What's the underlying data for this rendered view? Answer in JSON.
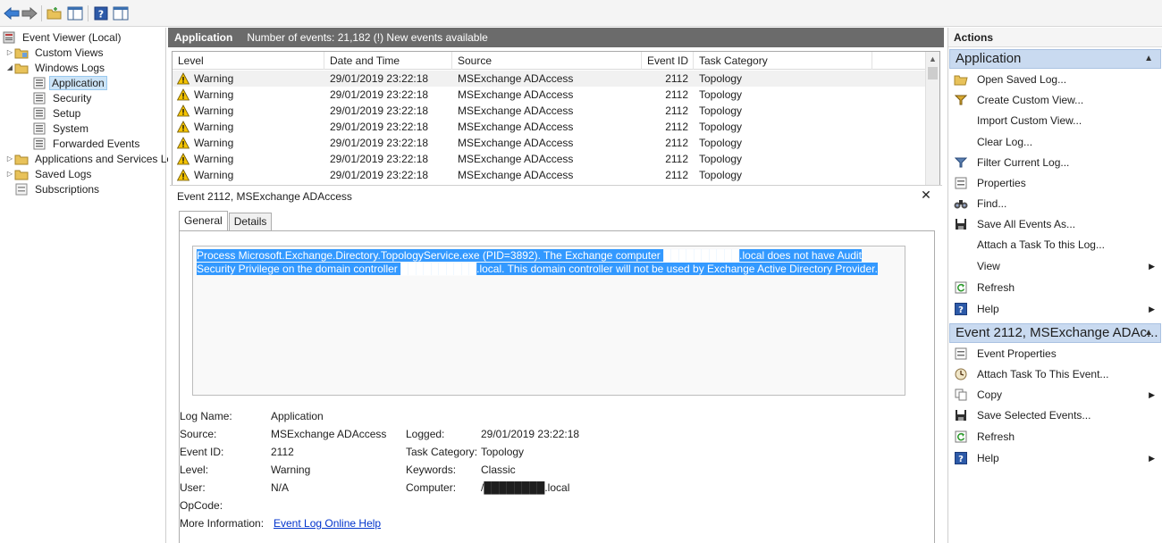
{
  "tree": {
    "root": "Event Viewer (Local)",
    "custom_views": "Custom Views",
    "windows_logs": "Windows Logs",
    "application": "Application",
    "security": "Security",
    "setup": "Setup",
    "system": "System",
    "forwarded_events": "Forwarded Events",
    "apps_services": "Applications and Services Lo",
    "saved_logs": "Saved Logs",
    "subscriptions": "Subscriptions"
  },
  "header": {
    "title": "Application",
    "event_count": "Number of events: 21,182 (!) New events available"
  },
  "grid": {
    "columns": [
      "Level",
      "Date and Time",
      "Source",
      "Event ID",
      "Task Category"
    ],
    "rows": [
      {
        "level": "Warning",
        "date": "29/01/2019 23:22:18",
        "source": "MSExchange ADAccess",
        "event_id": "2112",
        "category": "Topology"
      },
      {
        "level": "Warning",
        "date": "29/01/2019 23:22:18",
        "source": "MSExchange ADAccess",
        "event_id": "2112",
        "category": "Topology"
      },
      {
        "level": "Warning",
        "date": "29/01/2019 23:22:18",
        "source": "MSExchange ADAccess",
        "event_id": "2112",
        "category": "Topology"
      },
      {
        "level": "Warning",
        "date": "29/01/2019 23:22:18",
        "source": "MSExchange ADAccess",
        "event_id": "2112",
        "category": "Topology"
      },
      {
        "level": "Warning",
        "date": "29/01/2019 23:22:18",
        "source": "MSExchange ADAccess",
        "event_id": "2112",
        "category": "Topology"
      },
      {
        "level": "Warning",
        "date": "29/01/2019 23:22:18",
        "source": "MSExchange ADAccess",
        "event_id": "2112",
        "category": "Topology"
      },
      {
        "level": "Warning",
        "date": "29/01/2019 23:22:18",
        "source": "MSExchange ADAccess",
        "event_id": "2112",
        "category": "Topology"
      }
    ]
  },
  "detail": {
    "title": "Event 2112, MSExchange ADAccess",
    "tab_general": "General",
    "tab_details": "Details",
    "description": "Process Microsoft.Exchange.Directory.TopologyService.exe (PID=3892). The Exchange computer ██████████.local does not have Audit Security Privilege on the domain controller ██████████.local. This domain controller will not be used by Exchange Active Directory Provider.",
    "log_name_label": "Log Name:",
    "log_name": "Application",
    "source_label": "Source:",
    "source": "MSExchange ADAccess",
    "logged_label": "Logged:",
    "logged": "29/01/2019 23:22:18",
    "event_id_label": "Event ID:",
    "event_id": "2112",
    "task_category_label": "Task Category:",
    "task_category": "Topology",
    "level_label": "Level:",
    "level": "Warning",
    "keywords_label": "Keywords:",
    "keywords": "Classic",
    "user_label": "User:",
    "user": "N/A",
    "computer_label": "Computer:",
    "computer": "/████████.local",
    "opcode_label": "OpCode:",
    "more_info_label": "More Information:",
    "more_info_link": "Event Log Online Help"
  },
  "actions": {
    "title": "Actions",
    "section1": "Application",
    "open_saved_log": "Open Saved Log...",
    "create_custom_view": "Create Custom View...",
    "import_custom_view": "Import Custom View...",
    "clear_log": "Clear Log...",
    "filter_current_log": "Filter Current Log...",
    "properties": "Properties",
    "find": "Find...",
    "save_all_events_as": "Save All Events As...",
    "attach_task_log": "Attach a Task To this Log...",
    "view": "View",
    "refresh1": "Refresh",
    "help1": "Help",
    "section2": "Event 2112, MSExchange ADAc...",
    "event_properties": "Event Properties",
    "attach_task_event": "Attach Task To This Event...",
    "copy": "Copy",
    "save_selected_events": "Save Selected Events...",
    "refresh2": "Refresh",
    "help2": "Help"
  },
  "colors": {
    "header_bg": "#6b6b6b",
    "section_bg": "#c9daf0",
    "selection_blue": "#3399ff",
    "link": "#0033cc",
    "warning_yellow": "#f5c400"
  }
}
